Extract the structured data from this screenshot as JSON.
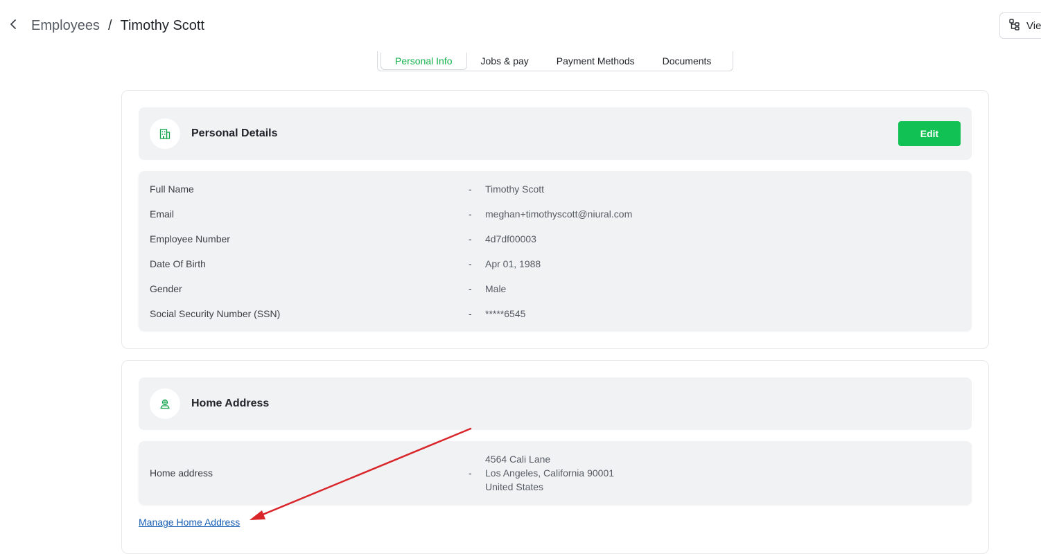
{
  "header": {
    "breadcrumb_parent": "Employees",
    "breadcrumb_separator": "/",
    "breadcrumb_current": "Timothy Scott",
    "view_button_label": "Vie"
  },
  "tabs": [
    {
      "label": "Personal Info",
      "active": true
    },
    {
      "label": "Jobs & pay",
      "active": false
    },
    {
      "label": "Payment Methods",
      "active": false
    },
    {
      "label": "Documents",
      "active": false
    }
  ],
  "personal_details": {
    "title": "Personal Details",
    "edit_label": "Edit",
    "rows": [
      {
        "label": "Full Name",
        "value": "Timothy Scott"
      },
      {
        "label": "Email",
        "value": "meghan+timothyscott@niural.com"
      },
      {
        "label": "Employee Number",
        "value": "4d7df00003"
      },
      {
        "label": "Date Of Birth",
        "value": "Apr 01, 1988"
      },
      {
        "label": "Gender",
        "value": "Male"
      },
      {
        "label": "Social Security Number (SSN)",
        "value": "*****6545"
      }
    ]
  },
  "home_address": {
    "title": "Home Address",
    "label": "Home address",
    "lines": [
      "4564 Cali Lane",
      "Los Angeles, California 90001",
      "United States"
    ],
    "manage_link": "Manage Home Address"
  },
  "separator": "-",
  "colors": {
    "accent_green": "#12c153",
    "active_tab_text": "#12b14c",
    "link_blue": "#1a5fb4",
    "annotation_red": "#d9262b",
    "panel_gray": "#f1f2f4"
  }
}
